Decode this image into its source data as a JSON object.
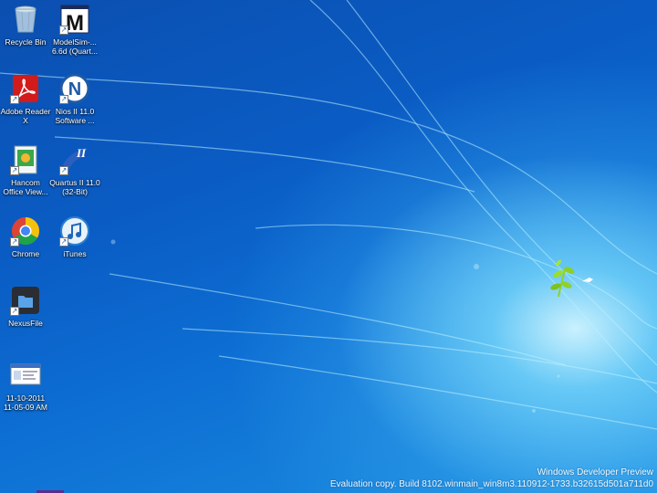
{
  "desktop_icons": [
    {
      "label": "Recycle Bin",
      "icon": "recycle-bin-icon"
    },
    {
      "label": "ModelSim-... 6.6d (Quart...",
      "icon": "modelsim-icon"
    },
    {
      "label": "Adobe Reader X",
      "icon": "adobe-reader-icon"
    },
    {
      "label": "Nios II 11.0 Software ...",
      "icon": "nios-icon"
    },
    {
      "label": "Hancom Office View...",
      "icon": "hancom-icon"
    },
    {
      "label": "Quartus II 11.0 (32-Bit)",
      "icon": "quartus-icon"
    },
    {
      "label": "Chrome",
      "icon": "chrome-icon"
    },
    {
      "label": "iTunes",
      "icon": "itunes-icon"
    },
    {
      "label": "NexusFile",
      "icon": "nexusfile-icon"
    },
    {
      "label": "11-10-2011 11-05-09 AM",
      "icon": "screenshot-file-icon"
    }
  ],
  "watermark": {
    "line1": "Windows Developer Preview",
    "line2": "Evaluation copy. Build 8102.winmain_win8m3.110912-1733.b32615d501a711d0"
  },
  "colors": {
    "background_dark": "#0b4fb0",
    "background_light": "#7fd6fb",
    "adobe_red": "#d21b1b",
    "chrome_green": "#1ea446",
    "chrome_red": "#db4437",
    "chrome_yellow": "#f4c20d"
  }
}
